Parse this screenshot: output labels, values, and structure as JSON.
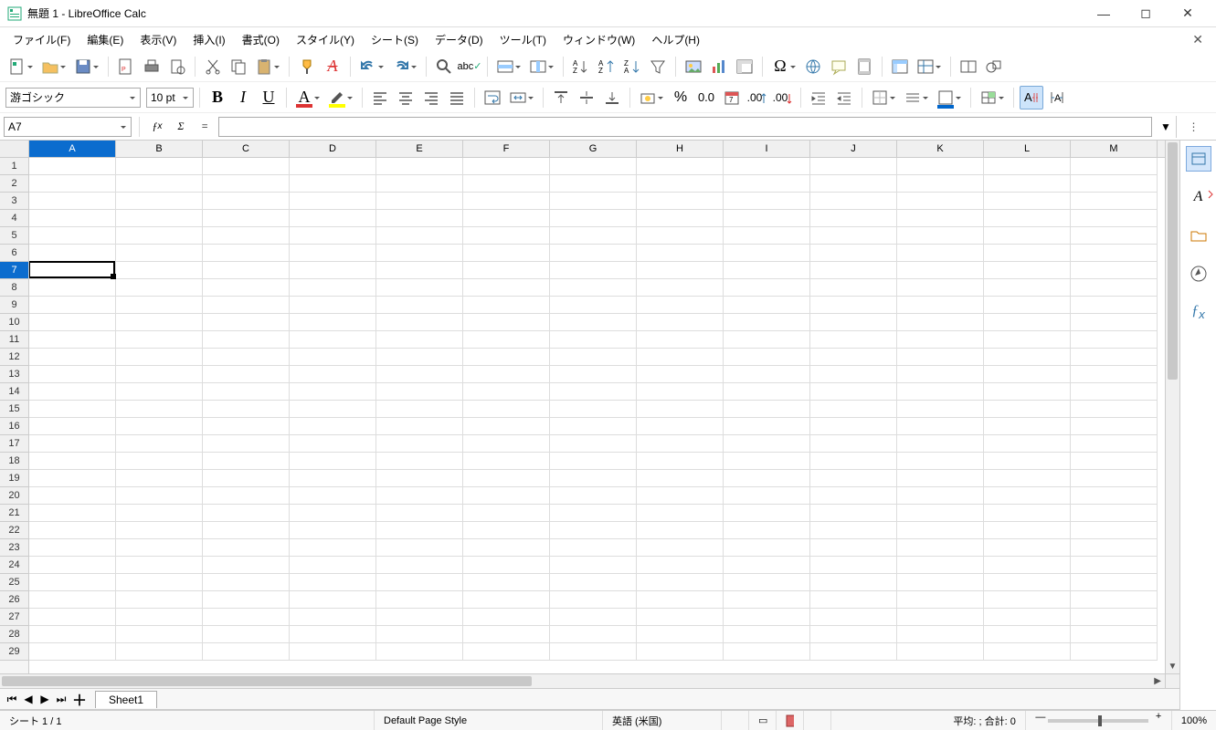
{
  "title_bar": {
    "title": "無題 1 - LibreOffice Calc"
  },
  "menu": {
    "file": "ファイル(F)",
    "edit": "編集(E)",
    "view": "表示(V)",
    "insert": "挿入(I)",
    "format": "書式(O)",
    "style": "スタイル(Y)",
    "sheet": "シート(S)",
    "data": "データ(D)",
    "tools": "ツール(T)",
    "window": "ウィンドウ(W)",
    "help": "ヘルプ(H)"
  },
  "format_bar": {
    "font_name": "游ゴシック",
    "font_size": "10 pt"
  },
  "formula_bar": {
    "cell_ref": "A7",
    "formula": ""
  },
  "columns": [
    "A",
    "B",
    "C",
    "D",
    "E",
    "F",
    "G",
    "H",
    "I",
    "J",
    "K",
    "L",
    "M"
  ],
  "rows": [
    1,
    2,
    3,
    4,
    5,
    6,
    7,
    8,
    9,
    10,
    11,
    12,
    13,
    14,
    15,
    16,
    17,
    18,
    19,
    20,
    21,
    22,
    23,
    24,
    25,
    26,
    27,
    28,
    29
  ],
  "selected": {
    "row": 7,
    "col": "A",
    "row_index": 6,
    "col_index": 0
  },
  "tabs": {
    "sheet1": "Sheet1"
  },
  "status": {
    "sheet_info": "シート 1 / 1",
    "page_style": "Default Page Style",
    "language": "英語 (米国)",
    "stats": "平均: ; 合計: 0",
    "zoom": "100%"
  }
}
